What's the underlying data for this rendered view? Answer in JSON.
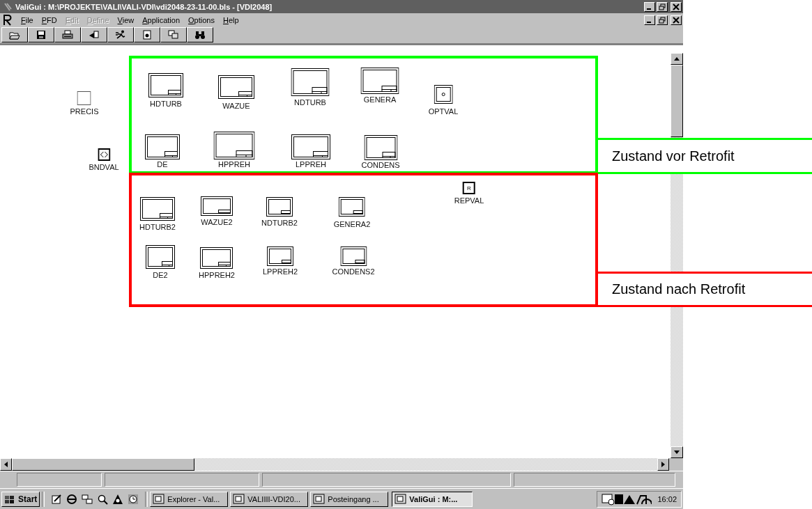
{
  "window": {
    "title": "ValiGui : M:\\PROJEKTE\\VALI\\VALI-VDI\\vdi2048-23-11-00.bls - [VDI2048]"
  },
  "menu": [
    {
      "label": "File",
      "disabled": false
    },
    {
      "label": "PFD",
      "disabled": false
    },
    {
      "label": "Edit",
      "disabled": true
    },
    {
      "label": "Define",
      "disabled": true
    },
    {
      "label": "View",
      "disabled": false
    },
    {
      "label": "Application",
      "disabled": false
    },
    {
      "label": "Options",
      "disabled": false
    },
    {
      "label": "Help",
      "disabled": false
    }
  ],
  "canvas": {
    "nodes": [
      {
        "label": "HDTURB",
        "kind": "unit"
      },
      {
        "label": "WAZUE",
        "kind": "unit"
      },
      {
        "label": "NDTURB",
        "kind": "unit"
      },
      {
        "label": "GENERA",
        "kind": "unit"
      },
      {
        "label": "PRECIS",
        "kind": "precis"
      },
      {
        "label": "OPTVAL",
        "kind": "optval"
      },
      {
        "label": "BNDVAL",
        "kind": "bndval"
      },
      {
        "label": "DE",
        "kind": "unit"
      },
      {
        "label": "HPPREH",
        "kind": "unit"
      },
      {
        "label": "LPPREH",
        "kind": "unit"
      },
      {
        "label": "CONDENS",
        "kind": "unit"
      },
      {
        "label": "REPVAL",
        "kind": "repval",
        "symbol": "R"
      },
      {
        "label": "HDTURB2",
        "kind": "unit"
      },
      {
        "label": "WAZUE2",
        "kind": "unit"
      },
      {
        "label": "NDTURB2",
        "kind": "unit"
      },
      {
        "label": "GENERA2",
        "kind": "unit"
      },
      {
        "label": "DE2",
        "kind": "unit"
      },
      {
        "label": "HPPREH2",
        "kind": "unit"
      },
      {
        "label": "LPPREH2",
        "kind": "unit"
      },
      {
        "label": "CONDENS2",
        "kind": "unit"
      }
    ],
    "regions": [
      {
        "label": "Zustand vor Retrofit",
        "color": "#00ff00"
      },
      {
        "label": "Zustand nach Retrofit",
        "color": "#ff0000"
      }
    ]
  },
  "taskbar": {
    "start": "Start",
    "tasks": [
      {
        "label": "Explorer - Val...",
        "selected": false
      },
      {
        "label": "VALIIII-VDI20...",
        "selected": false
      },
      {
        "label": "Posteingang ...",
        "selected": false
      },
      {
        "label": "ValiGui : M:...",
        "selected": true
      }
    ],
    "clock": "16:02"
  }
}
